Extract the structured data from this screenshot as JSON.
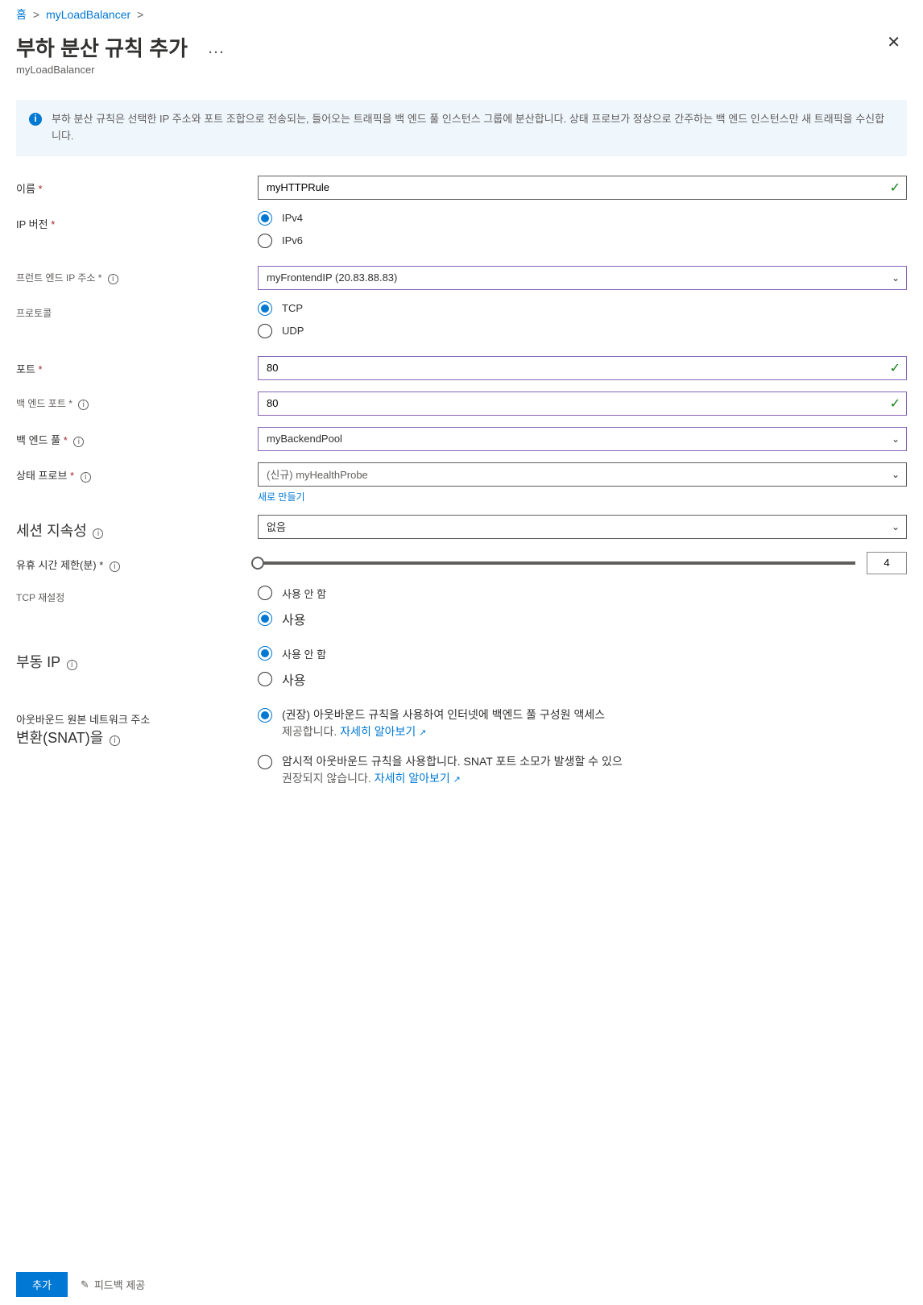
{
  "breadcrumb": {
    "home": "홈",
    "resource": "myLoadBalancer"
  },
  "header": {
    "title": "부하 분산 규칙 추가",
    "subtitle": "myLoadBalancer"
  },
  "info": {
    "text": "부하 분산 규칙은 선택한 IP 주소와 포트 조합으로 전송되는, 들어오는 트래픽을 백 엔드 풀 인스턴스 그룹에 분산합니다. 상태 프로브가 정상으로 간주하는 백 엔드 인스턴스만 새 트래픽을 수신합니다."
  },
  "form": {
    "name": {
      "label": "이름",
      "value": "myHTTPRule"
    },
    "ipVersion": {
      "label": "IP 버전",
      "options": {
        "ipv4": "IPv4",
        "ipv6": "IPv6"
      },
      "selected": "ipv4"
    },
    "frontendIp": {
      "label": "프런트 엔드 IP 주소",
      "value": "myFrontendIP (20.83.88.83)"
    },
    "protocol": {
      "label": "프로토콜",
      "options": {
        "tcp": "TCP",
        "udp": "UDP"
      },
      "selected": "tcp"
    },
    "port": {
      "label": "포트",
      "value": "80"
    },
    "backendPort": {
      "label": "백 엔드 포트",
      "value": "80"
    },
    "backendPool": {
      "label": "백 엔드 풀",
      "value": "myBackendPool"
    },
    "healthProbe": {
      "label": "상태 프로브",
      "value": "(신규) myHealthProbe",
      "createNew": "새로 만들기"
    },
    "sessionPersistence": {
      "label": "세션 지속성",
      "value": "없음"
    },
    "idleTimeout": {
      "label": "유휴 시간 제한(분)",
      "value": "4"
    },
    "tcpReset": {
      "label": "TCP 재설정",
      "options": {
        "disabled": "사용 안 함",
        "enabled": "사용"
      },
      "selected": "enabled"
    },
    "floatingIp": {
      "label": "부동 IP",
      "options": {
        "disabled": "사용 안 함",
        "enabled": "사용"
      },
      "selected": "disabled"
    },
    "snat": {
      "label1": "아웃바운드 원본 네트워크 주소",
      "label2": "변환(SNAT)을",
      "opt1_a": "(권장) 아웃바운드 규칙을 사용하여 인터넷에 백엔드 풀 구성원 액세스",
      "opt1_b": "제공합니다.",
      "learnMore1": "자세히 알아보기",
      "opt2_a": "암시적 아웃바운드 규칙을 사용합니다. SNAT 포트 소모가 발생할 수 있으",
      "opt2_b": "권장되지 않습니다.",
      "learnMore2": "자세히 알아보기",
      "selected": "recommended"
    }
  },
  "footer": {
    "add": "추가",
    "feedback": "피드백 제공"
  }
}
